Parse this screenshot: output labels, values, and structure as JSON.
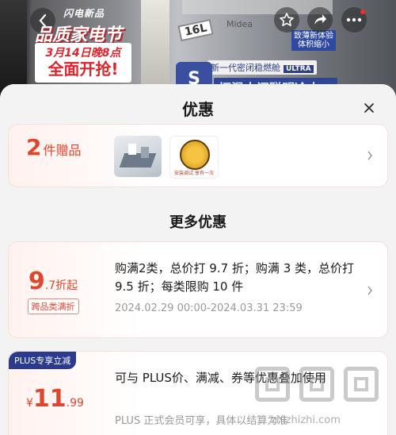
{
  "banner": {
    "flash_label": "闪电新品",
    "event_title": "品质家电节",
    "event_date_prefix": "3月14日",
    "event_date_suffix": "晚8点",
    "event_open": "全面开抢!",
    "capacity_badge": "16L",
    "brand": "Midea",
    "feature_line": "新一代密闭稳燃舱",
    "feature_tag": "ULTRA",
    "side_tag_line1": "致薄新体验",
    "side_tag_line2": "体积缩小",
    "shield_letter": "S",
    "slogan": "恒温水阀聪明冷水"
  },
  "sheet": {
    "title": "优惠",
    "close_icon": "close-icon",
    "gift": {
      "count": "2",
      "count_label": "件赠品",
      "thumb_caption": "安装调试 享有一次"
    },
    "more_title": "更多优惠",
    "discount": {
      "value_big": "9",
      "value_small": ".7折起",
      "tag": "跨品类满折",
      "text": "购满2类，总价打 9.7 折；购满 3 类，总价打 9.5 折；每类限购 10 件",
      "date": "2024.02.29 00:00-2024.03.31 23:59"
    },
    "plus": {
      "tag": "PLUS专享立减",
      "currency": "¥",
      "price_int": "11",
      "price_dec": ".99",
      "text": "可与 PLUS价、满减、券等优惠叠加使用",
      "sub": "PLUS 正式会员可享，具体以结算为准"
    }
  },
  "watermark": {
    "url": "zhizhizhi.com"
  },
  "colors": {
    "accent_red": "#e0462e",
    "plus_blue": "#2a3a8f"
  }
}
